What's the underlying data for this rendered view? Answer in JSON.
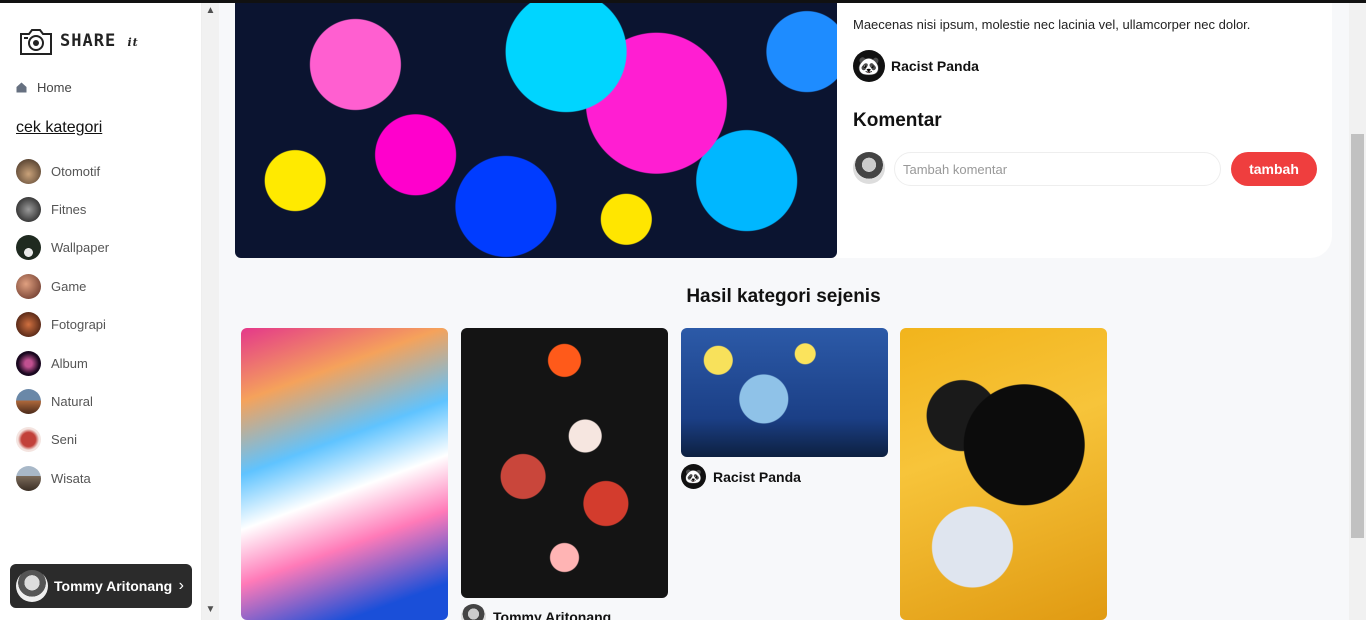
{
  "app": {
    "logo_text": "SHARE",
    "logo_suffix": "it"
  },
  "sidebar": {
    "home_label": "Home",
    "category_title": "cek kategori",
    "categories": [
      {
        "label": "Otomotif",
        "color": "#8a6d55"
      },
      {
        "label": "Fitnes",
        "color": "#2f2f2f"
      },
      {
        "label": "Wallpaper",
        "color": "#1f2a20"
      },
      {
        "label": "Game",
        "color": "#9a4b3a"
      },
      {
        "label": "Fotograpi",
        "color": "#6b2a1e"
      },
      {
        "label": "Album",
        "color": "#2a1030"
      },
      {
        "label": "Natural",
        "color": "#b06a3c"
      },
      {
        "label": "Seni",
        "color": "#c2413a"
      },
      {
        "label": "Wisata",
        "color": "#7a6a5a"
      }
    ],
    "user": {
      "name": "Tommy Aritonang"
    }
  },
  "post": {
    "description": "Maecenas nisi ipsum, molestie nec lacinia vel, ullamcorper nec dolor.",
    "author": "Racist Panda"
  },
  "comments": {
    "title": "Komentar",
    "input_placeholder": "Tambah komentar",
    "submit_label": "tambah"
  },
  "related": {
    "title": "Hasil kategori sejenis",
    "items": [
      {
        "author": ""
      },
      {
        "author": "Tommy Aritonang"
      },
      {
        "author": "Racist Panda"
      },
      {
        "author": ""
      }
    ]
  },
  "colors": {
    "accent": "#ef3e3e",
    "user_card": "#2b2b2b"
  }
}
